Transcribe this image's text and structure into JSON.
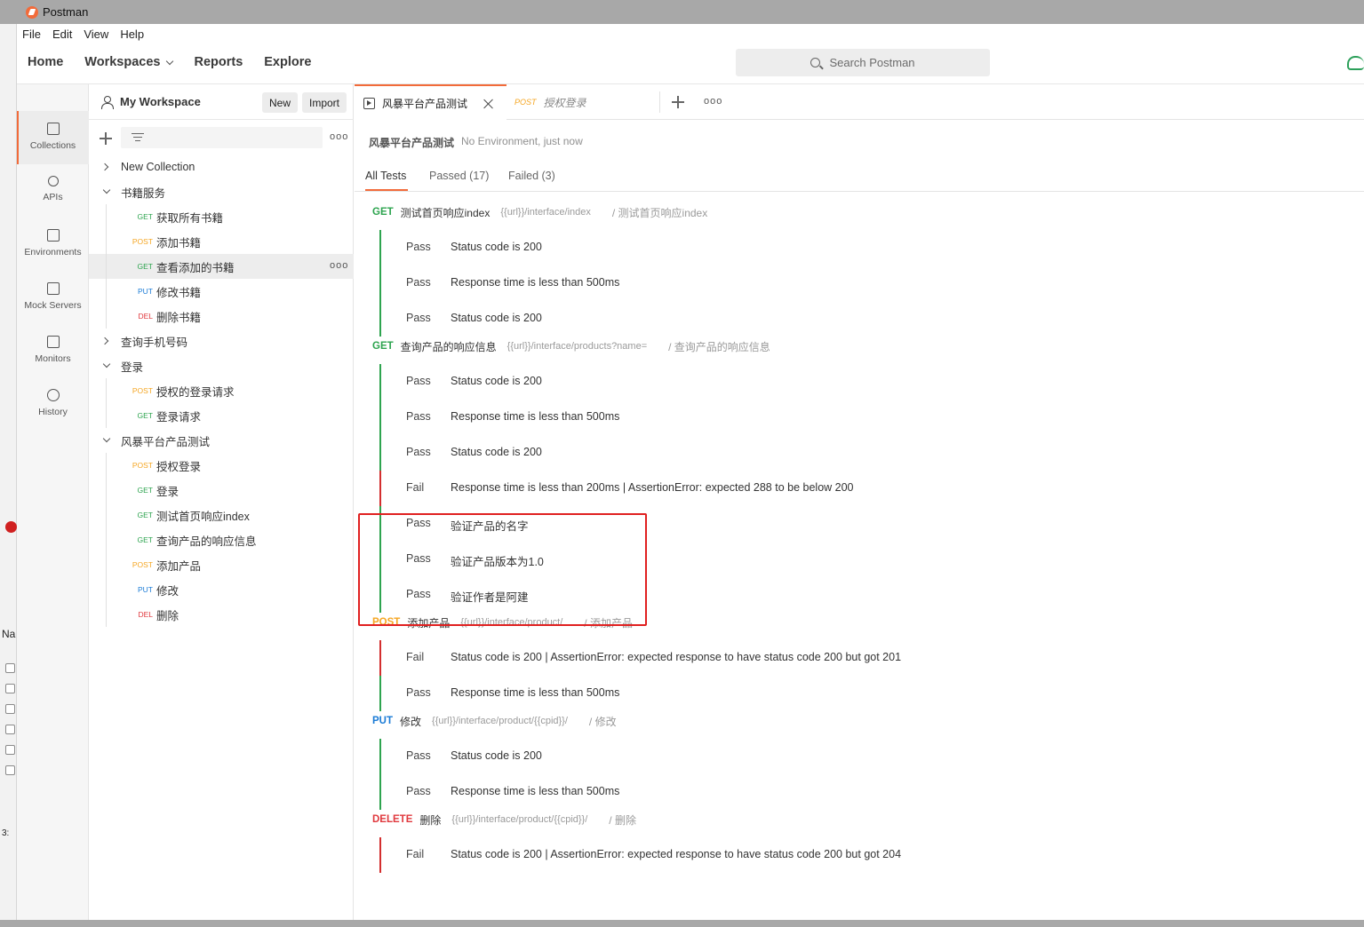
{
  "window": {
    "title": "Postman"
  },
  "menu": [
    "File",
    "Edit",
    "View",
    "Help"
  ],
  "header": {
    "nav": [
      "Home",
      "Workspaces",
      "Reports",
      "Explore"
    ],
    "search_placeholder": "Search Postman"
  },
  "rail": [
    {
      "label": "Collections",
      "icon": "collections-icon",
      "active": true
    },
    {
      "label": "APIs",
      "icon": "apis-icon"
    },
    {
      "label": "Environments",
      "icon": "environments-icon"
    },
    {
      "label": "Mock Servers",
      "icon": "mock-servers-icon"
    },
    {
      "label": "Monitors",
      "icon": "monitors-icon"
    },
    {
      "label": "History",
      "icon": "history-icon"
    }
  ],
  "workspace": {
    "name": "My Workspace",
    "new_label": "New",
    "import_label": "Import"
  },
  "tree": [
    {
      "type": "folder",
      "label": "New Collection",
      "expanded": false
    },
    {
      "type": "folder",
      "label": "书籍服务",
      "expanded": true
    },
    {
      "type": "request",
      "method": "GET",
      "label": "获取所有书籍"
    },
    {
      "type": "request",
      "method": "POST",
      "label": "添加书籍"
    },
    {
      "type": "request",
      "method": "GET",
      "label": "查看添加的书籍",
      "selected": true
    },
    {
      "type": "request",
      "method": "PUT",
      "label": "修改书籍"
    },
    {
      "type": "request",
      "method": "DEL",
      "label": "删除书籍"
    },
    {
      "type": "folder",
      "label": "查询手机号码",
      "expanded": false
    },
    {
      "type": "folder",
      "label": "登录",
      "expanded": true
    },
    {
      "type": "request",
      "method": "POST",
      "label": "授权的登录请求"
    },
    {
      "type": "request",
      "method": "GET",
      "label": "登录请求"
    },
    {
      "type": "folder",
      "label": "风暴平台产品测试",
      "expanded": true
    },
    {
      "type": "request",
      "method": "POST",
      "label": "授权登录"
    },
    {
      "type": "request",
      "method": "GET",
      "label": "登录"
    },
    {
      "type": "request",
      "method": "GET",
      "label": "测试首页响应index"
    },
    {
      "type": "request",
      "method": "GET",
      "label": "查询产品的响应信息"
    },
    {
      "type": "request",
      "method": "POST",
      "label": "添加产品"
    },
    {
      "type": "request",
      "method": "PUT",
      "label": "修改"
    },
    {
      "type": "request",
      "method": "DEL",
      "label": "删除"
    }
  ],
  "tabs": [
    {
      "label": "风暴平台产品测试",
      "active": true
    },
    {
      "method": "POST",
      "label": "授权登录"
    }
  ],
  "run": {
    "title": "风暴平台产品测试",
    "subtitle": "No Environment, just now",
    "subtabs": [
      "All Tests",
      "Passed (17)",
      "Failed (3)"
    ]
  },
  "results": [
    {
      "method": "GET",
      "name": "测试首页响应index",
      "url": "{{url}}/interface/index",
      "path": "/ 测试首页响应index",
      "tests": [
        {
          "status": "Pass",
          "text": "Status code is 200"
        },
        {
          "status": "Pass",
          "text": "Response time is less than 500ms"
        },
        {
          "status": "Pass",
          "text": "Status code is 200"
        }
      ]
    },
    {
      "method": "GET",
      "name": "查询产品的响应信息",
      "url": "{{url}}/interface/products?name=",
      "path": "/ 查询产品的响应信息",
      "tests": [
        {
          "status": "Pass",
          "text": "Status code is 200"
        },
        {
          "status": "Pass",
          "text": "Response time is less than 500ms"
        },
        {
          "status": "Pass",
          "text": "Status code is 200"
        },
        {
          "status": "Fail",
          "text": "Response time is less than 200ms | AssertionError: expected 288 to be below 200"
        },
        {
          "status": "Pass",
          "text": "验证产品的名字"
        },
        {
          "status": "Pass",
          "text": "验证产品版本为1.0"
        },
        {
          "status": "Pass",
          "text": "验证作者是阿建"
        }
      ]
    },
    {
      "method": "POST",
      "name": "添加产品",
      "url": "{{url}}/interface/product/",
      "path": "/ 添加产品",
      "tests": [
        {
          "status": "Fail",
          "text": "Status code is 200 | AssertionError: expected response to have status code 200 but got 201"
        },
        {
          "status": "Pass",
          "text": "Response time is less than 500ms"
        }
      ]
    },
    {
      "method": "PUT",
      "name": "修改",
      "url": "{{url}}/interface/product/{{cpid}}/",
      "path": "/ 修改",
      "tests": [
        {
          "status": "Pass",
          "text": "Status code is 200"
        },
        {
          "status": "Pass",
          "text": "Response time is less than 500ms"
        }
      ]
    },
    {
      "method": "DELETE",
      "name": "删除",
      "url": "{{url}}/interface/product/{{cpid}}/",
      "path": "/ 删除",
      "tests": [
        {
          "status": "Fail",
          "text": "Status code is 200 | AssertionError: expected response to have status code 200 but got 204"
        }
      ]
    }
  ],
  "colors": {
    "accent": "#f26b3a",
    "GET": "#2ea44f",
    "POST": "#f5a623",
    "PUT": "#1a7bd6",
    "DEL": "#e0393e",
    "DELETE": "#e0393e",
    "pass": "#2ea44f",
    "fail": "#d32f2f",
    "highlight": "#e02020"
  },
  "left_strip_text": [
    "Na",
    "3:"
  ]
}
